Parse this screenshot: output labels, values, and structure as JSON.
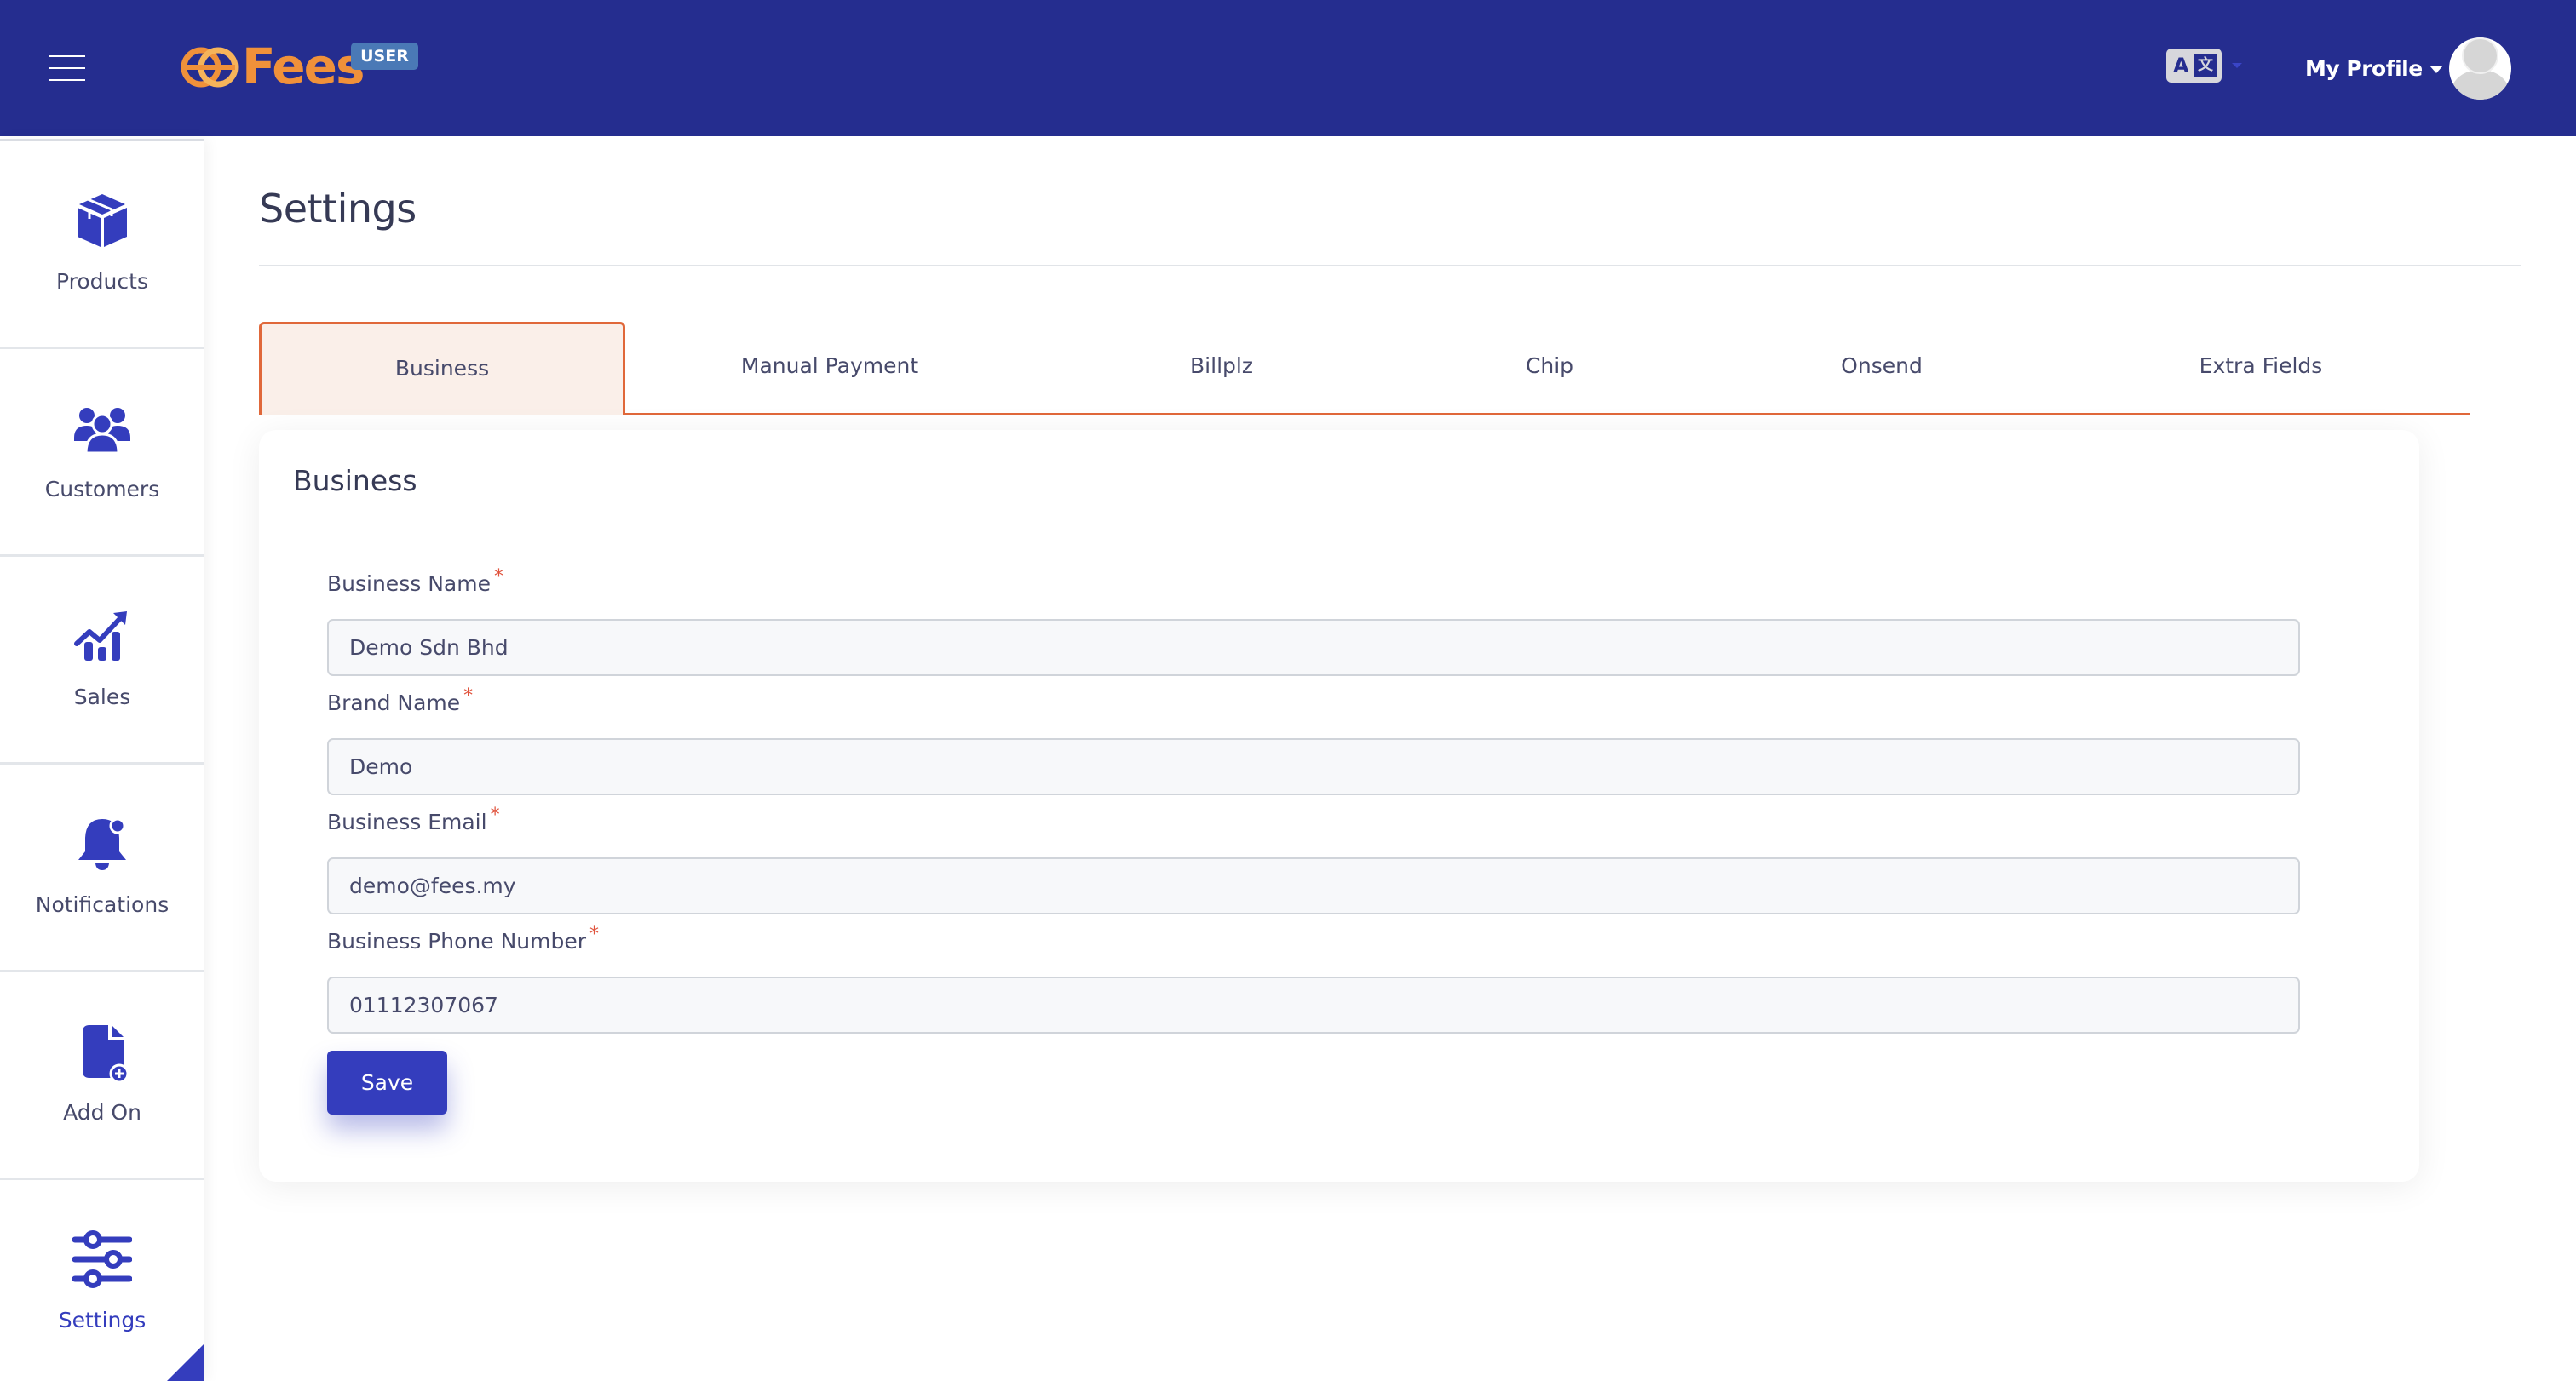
{
  "header": {
    "menu_icon": "hamburger-icon",
    "logo_text": "Fees",
    "role_badge": "USER",
    "language_icon": "translate-icon",
    "language_icon_latin": "A",
    "language_icon_cjk": "文",
    "profile_label": "My Profile",
    "avatar_icon": "user-avatar-icon"
  },
  "sidebar": {
    "items": [
      {
        "label": "Products",
        "icon": "box-icon",
        "active": false
      },
      {
        "label": "Customers",
        "icon": "users-icon",
        "active": false
      },
      {
        "label": "Sales",
        "icon": "chart-line-icon",
        "active": false
      },
      {
        "label": "Notifications",
        "icon": "bell-icon",
        "active": false
      },
      {
        "label": "Add On",
        "icon": "file-plus-icon",
        "active": false
      },
      {
        "label": "Settings",
        "icon": "sliders-icon",
        "active": true
      }
    ]
  },
  "page": {
    "title": "Settings"
  },
  "tabs": [
    {
      "label": "Business",
      "active": true
    },
    {
      "label": "Manual Payment",
      "active": false
    },
    {
      "label": "Billplz",
      "active": false
    },
    {
      "label": "Chip",
      "active": false
    },
    {
      "label": "Onsend",
      "active": false
    },
    {
      "label": "Extra Fields",
      "active": false
    }
  ],
  "form": {
    "title": "Business",
    "required_marker": "*",
    "fields": [
      {
        "label": "Business Name",
        "value": "Demo Sdn Bhd",
        "required": true
      },
      {
        "label": "Brand Name",
        "value": "Demo",
        "required": true
      },
      {
        "label": "Business Email",
        "value": "demo@fees.my",
        "required": true
      },
      {
        "label": "Business Phone Number",
        "value": "01112307067",
        "required": true
      }
    ],
    "save_label": "Save"
  },
  "colors": {
    "header_bg": "#252d8f",
    "brand_orange": "#f0913a",
    "primary": "#343dbd",
    "tab_accent": "#e0683a",
    "required": "#e0533d"
  }
}
